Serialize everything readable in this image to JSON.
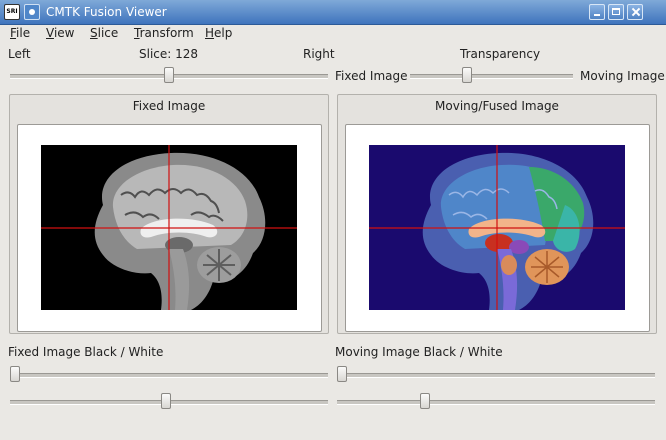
{
  "window": {
    "title": "CMTK Fusion Viewer",
    "app_icon_text": "SRI"
  },
  "menu": [
    {
      "accel": "F",
      "rest": "ile"
    },
    {
      "accel": "V",
      "rest": "iew"
    },
    {
      "accel": "S",
      "rest": "lice"
    },
    {
      "accel": "T",
      "rest": "ransform"
    },
    {
      "accel": "H",
      "rest": "elp"
    }
  ],
  "slice_control": {
    "left_label": "Left",
    "slice_label": "Slice: 128",
    "right_label": "Right",
    "position_fraction": 0.5
  },
  "transparency_control": {
    "title": "Transparency",
    "left_label": "Fixed Image",
    "right_label": "Moving Image",
    "position_fraction": 0.34
  },
  "panels": {
    "fixed": {
      "title": "Fixed Image"
    },
    "moving": {
      "title": "Moving/Fused Image"
    }
  },
  "fixed_bw": {
    "label": "Fixed Image Black / White",
    "black_fraction": 0.0,
    "white_fraction": 0.49
  },
  "moving_bw": {
    "label": "Moving Image Black / White",
    "black_fraction": 0.0,
    "white_fraction": 0.27
  },
  "colors": {
    "crosshair": "#d01010",
    "fixed_background": "#000000",
    "fused_background": "#1a0a6e"
  }
}
